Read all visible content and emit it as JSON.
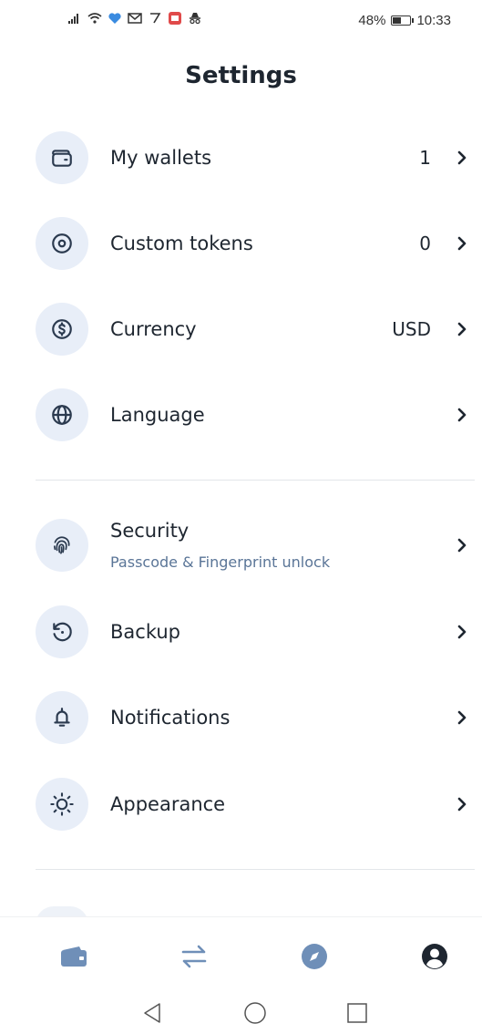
{
  "status_bar": {
    "battery": "48%",
    "battery_level": 0.48,
    "time": "10:33"
  },
  "header": {
    "title": "Settings"
  },
  "groups": [
    {
      "items": [
        {
          "label": "My wallets",
          "value": "1",
          "icon": "wallet-icon"
        },
        {
          "label": "Custom tokens",
          "value": "0",
          "icon": "token-icon"
        },
        {
          "label": "Currency",
          "value": "USD",
          "icon": "dollar-circle-icon"
        },
        {
          "label": "Language",
          "value": "",
          "icon": "globe-icon"
        }
      ]
    },
    {
      "items": [
        {
          "label": "Security",
          "sublabel": "Passcode & Fingerprint unlock",
          "icon": "fingerprint-icon"
        },
        {
          "label": "Backup",
          "icon": "backup-icon"
        },
        {
          "label": "Notifications",
          "icon": "bell-icon"
        },
        {
          "label": "Appearance",
          "icon": "sun-icon"
        }
      ]
    }
  ],
  "bottom_nav": [
    {
      "name": "wallet",
      "icon": "wallet-tab-icon",
      "active": false
    },
    {
      "name": "swap",
      "icon": "swap-icon",
      "active": false
    },
    {
      "name": "browser",
      "icon": "compass-icon",
      "active": false
    },
    {
      "name": "settings",
      "icon": "user-circle-icon",
      "active": true
    }
  ],
  "colors": {
    "icon_bg": "#e8eef8",
    "icon_stroke": "#2b3a4f",
    "sublabel": "#5a7597",
    "nav_inactive": "#6f8fb8",
    "nav_active": "#1e2630"
  }
}
